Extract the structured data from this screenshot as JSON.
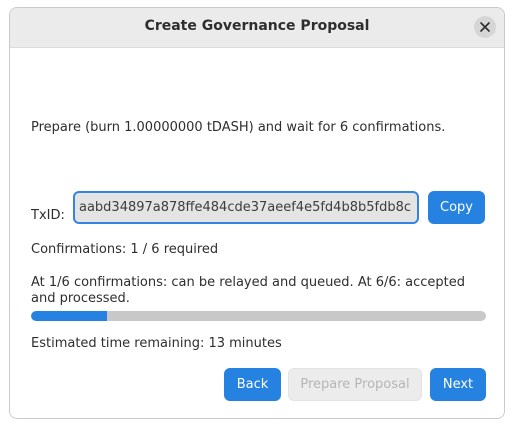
{
  "dialog": {
    "title": "Create Governance Proposal"
  },
  "content": {
    "prepare_text": "Prepare (burn 1.00000000 tDASH) and wait for 6 confirmations.",
    "txid_label": "TxID:",
    "txid_value": "aabd34897a878ffe484cde37aeef4e5fd4b8b5fdb8c",
    "copy_label": "Copy",
    "confirmations_text": "Confirmations: 1 / 6 required",
    "relay_text": "At 1/6 confirmations: can be relayed and queued. At 6/6: accepted and processed.",
    "progress_fraction": 0.1667,
    "time_remaining_text": "Estimated time remaining: 13 minutes"
  },
  "buttons": {
    "back_label": "Back",
    "prepare_label": "Prepare Proposal",
    "next_label": "Next"
  },
  "colors": {
    "accent": "#2582e0",
    "progress_track": "#c8c8c8"
  },
  "icons": {
    "close": "close-icon"
  }
}
